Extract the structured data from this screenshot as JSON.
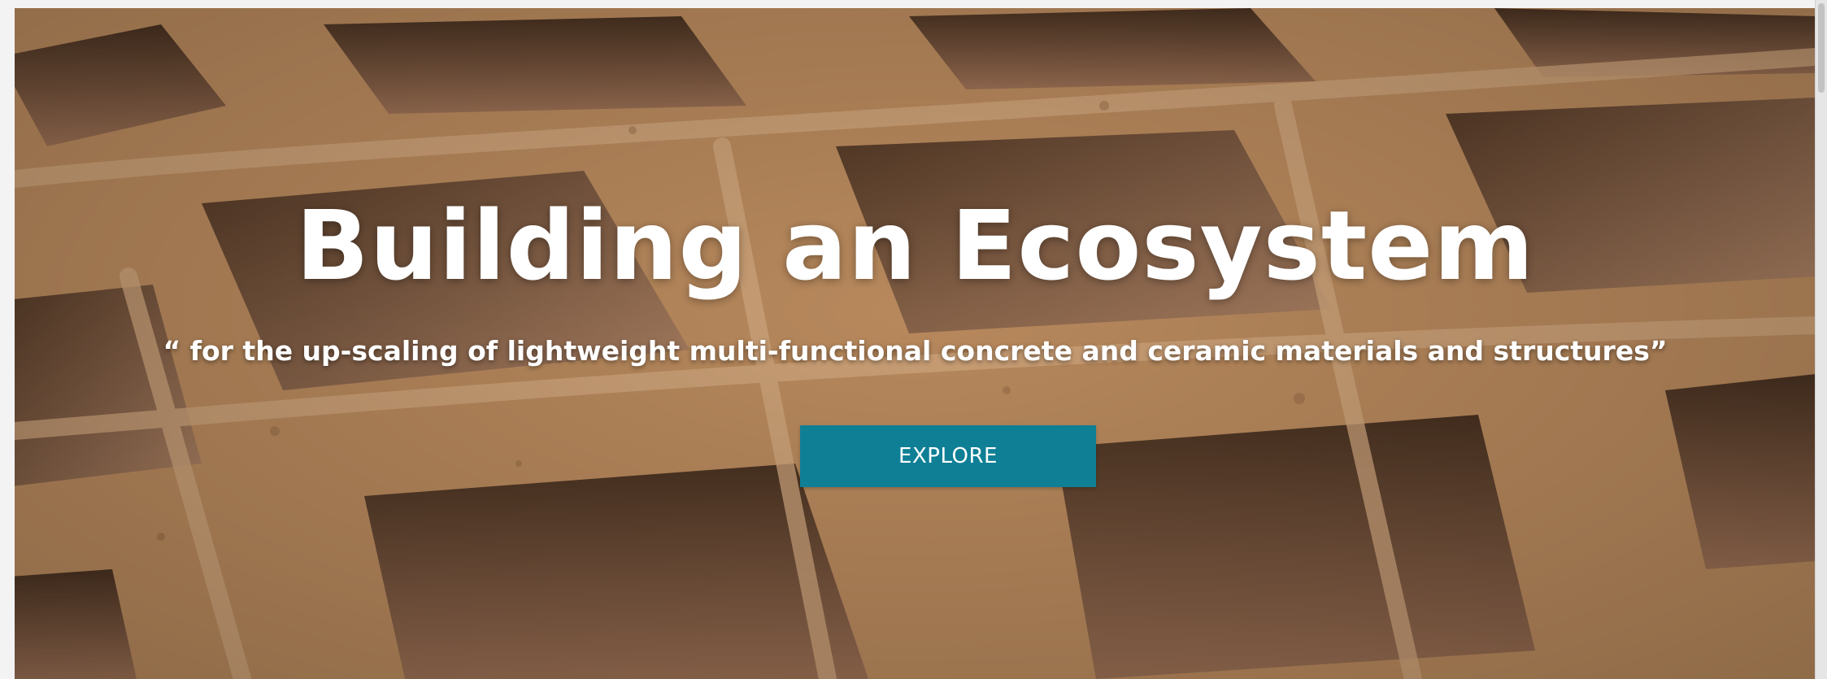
{
  "hero": {
    "headline": "Building an Ecosystem",
    "subline": "“ for the up-scaling of lightweight multi-functional concrete and ceramic materials and structures”",
    "cta_label": "EXPLORE",
    "background_image": "clay-brick-texture",
    "cta_color": "#0f7f96"
  },
  "colors": {
    "brick_light": "#d9a679",
    "brick_mid": "#c08a5b",
    "brick_dark": "#7c5436",
    "cavity": "#6b4a33"
  }
}
